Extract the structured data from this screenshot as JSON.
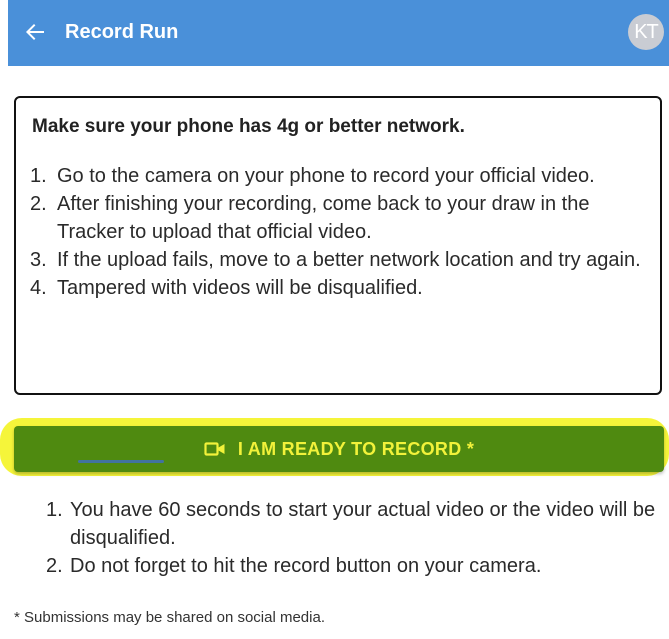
{
  "header": {
    "title": "Record Run",
    "back_icon": "arrow-left-icon",
    "avatar_initials": "KT",
    "background": "#4a90d9"
  },
  "instructions": {
    "heading": "Make sure your phone has 4g or better network.",
    "steps": [
      {
        "num": "1.",
        "text": "Go to the camera on your phone to record your official video."
      },
      {
        "num": "2.",
        "text": "After finishing your recording, come back to your draw in the Tracker to upload that official video."
      },
      {
        "num": "3.",
        "text": "If the upload fails, move to a better network location and try again."
      },
      {
        "num": "4.",
        "text": "Tampered with videos will be disqualified."
      }
    ]
  },
  "record_button": {
    "icon": "video-camera-icon",
    "label": "I AM READY TO RECORD *",
    "background": "#4f8a10",
    "text_color": "#f2f23a",
    "highlight_color": "#f5f53a"
  },
  "notes": [
    {
      "num": "1.",
      "text": "You have 60 seconds to start your actual video or the video will be disqualified."
    },
    {
      "num": "2.",
      "text": "Do not forget to hit the record button on your camera."
    }
  ],
  "footnote": "* Submissions may be shared on social media."
}
